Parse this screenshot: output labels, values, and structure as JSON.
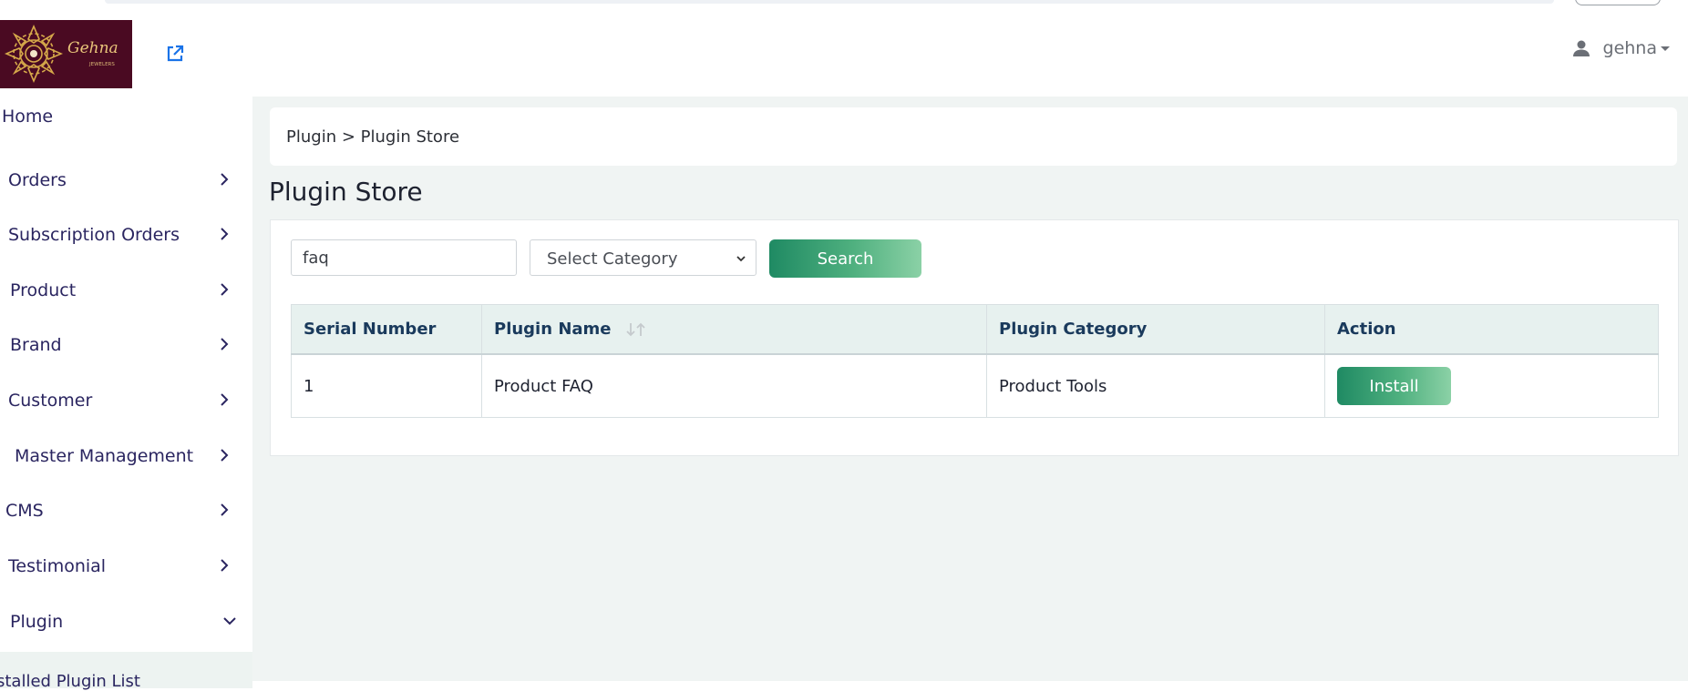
{
  "header": {
    "user_name": "gehna",
    "logo_text": "Gehna",
    "logo_subtext": "JEWELERS"
  },
  "sidebar": {
    "items": [
      {
        "label": "Home",
        "icon": "none"
      },
      {
        "label": "Orders",
        "icon": "chevron-right-icon"
      },
      {
        "label": "Subscription Orders",
        "icon": "chevron-right-icon"
      },
      {
        "label": "Product",
        "icon": "chevron-right-icon"
      },
      {
        "label": "Brand",
        "icon": "chevron-right-icon"
      },
      {
        "label": "Customer",
        "icon": "chevron-right-icon"
      },
      {
        "label": "Master Management",
        "icon": "chevron-right-icon"
      },
      {
        "label": "CMS",
        "icon": "chevron-right-icon"
      },
      {
        "label": "Testimonial",
        "icon": "chevron-right-icon"
      },
      {
        "label": "Plugin",
        "icon": "chevron-down-icon"
      }
    ],
    "sub_item": "stalled Plugin List"
  },
  "breadcrumb": "Plugin > Plugin Store",
  "page_title": "Plugin Store",
  "search": {
    "value": "faq",
    "category_selected": "Select Category",
    "button_label": "Search"
  },
  "table": {
    "headers": [
      "Serial Number",
      "Plugin Name",
      "Plugin Category",
      "Action"
    ],
    "rows": [
      {
        "serial": "1",
        "name": "Product FAQ",
        "category": "Product Tools",
        "action": "Install"
      }
    ]
  },
  "colors": {
    "accent_start": "#1f8a63",
    "accent_end": "#8bd1a6",
    "nav_text": "#2a2560",
    "header_bg": "#e7f1ef"
  }
}
